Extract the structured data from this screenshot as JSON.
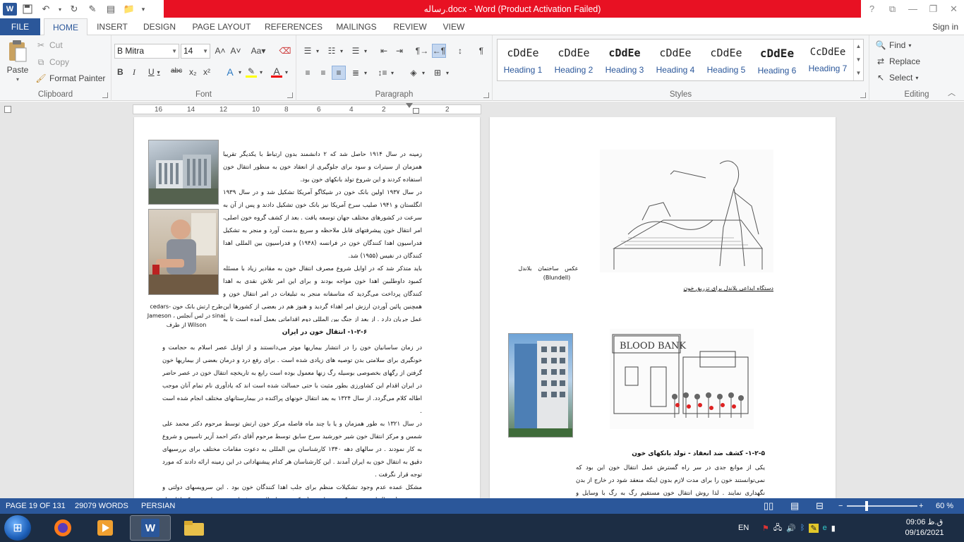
{
  "window": {
    "title": "رساله.docx -  Word (Product Activation Failed)"
  },
  "qat": {
    "customize": "▾"
  },
  "window_controls": {
    "help": "?",
    "restore_ribbon": "⧉",
    "minimize": "—",
    "maximize": "❐",
    "close": "✕"
  },
  "tabs": [
    "FILE",
    "HOME",
    "INSERT",
    "DESIGN",
    "PAGE LAYOUT",
    "REFERENCES",
    "MAILINGS",
    "REVIEW",
    "VIEW"
  ],
  "active_tab": "HOME",
  "signin": "Sign in",
  "clipboard": {
    "paste": "Paste",
    "cut": "Cut",
    "copy": "Copy",
    "format_painter": "Format Painter",
    "label": "Clipboard"
  },
  "font": {
    "name": "B Mitra",
    "size": "14",
    "label": "Font",
    "bold": "B",
    "italic": "I",
    "underline": "U",
    "strike": "abc",
    "sub": "x₂",
    "sup": "x²"
  },
  "paragraph": {
    "label": "Paragraph"
  },
  "styles": {
    "label": "Styles",
    "items": [
      {
        "sample": "cDdEe",
        "name": "Heading 1"
      },
      {
        "sample": "cDdEe",
        "name": "Heading 2"
      },
      {
        "sample": "cDdEe",
        "name": "Heading 3"
      },
      {
        "sample": "cDdEe",
        "name": "Heading 4"
      },
      {
        "sample": "cDdEe",
        "name": "Heading 5"
      },
      {
        "sample": "cDdEe",
        "name": "Heading 6"
      },
      {
        "sample": "CcDdEe",
        "name": "Heading 7"
      }
    ]
  },
  "editing": {
    "find": "Find",
    "replace": "Replace",
    "select": "Select",
    "label": "Editing"
  },
  "ruler": {
    "ticks": [
      "16",
      "14",
      "12",
      "10",
      "8",
      "6",
      "4",
      "2",
      "2"
    ]
  },
  "doc": {
    "left_page": {
      "paragraphs": [
        "زمینه در سال ۱۹۱۴ حاصل شد که ۲ دانشمند بدون ارتباط با یکدیگر تقریبا همزمان از سیترات و سود برای جلوگیری از انعقاد خون به منظور انتقال خون استفاده کردند و این شروع تولد بانکهای خون بود.",
        "در سال ۱۹۳۷ اولین بانک خون در شیکاگو آمریکا تشکیل شد و در سال ۱۹۳۹ انگلستان و ۱۹۴۱ صلیب سرخ آمریکا نیز بانک خون تشکیل دادند و پس از آن به سرعت در کشورهای مختلف جهان توسعه یافت . بعد از کشف گروه خون اصلی، امر انتقال خون پیشرفتهای قابل ملاحظه و سریع بدست آورد و منجر به تشکیل فدراسیون اهدا کنندگان خون در فرانسه (۱۹۴۸) و فدراسیون بین المللی اهدا کنندگان در نفیس (۱۹۵۵) شد.",
        "باید متذکر شد که در اوایل شروع مصرف انتقال خون به مقادیر زیاد با مسئله کمبود داوطلبین اهدا خون مواجه بودند و برای این امر تلاش نقدی به اهدا کنندگان پرداخت می‌گردید که متاسفانه منجر به تبلیغات در امر انتقال خون و همچنین پائین آوردن ارزش امر اهداء گردید و هنوز هم در بعضی از کشورها این عمل جریان دارد . از بعد از جنگ بین المللی دوم اقداماتی بعمل آمده است تا به خرید و فروش خون که تا حدی با خرید و فروش برده مطابقت دارد پایان داده شود."
      ],
      "heading": "۱-۲-۶- انتقال خون در ایران",
      "paragraphs2": [
        "در زمان ساسانیان خون را در انتشار بیماریها موثر می‌دانستند و از اوایل عصر اسلام به حجامت و خونگیری برای سلامتی بدن توصیه های زیادی شده است . برای رفع درد و درمان بعضی از بیماریها خون گرفتن از رگهای بخصوصی بوسیله رگ زنها معمول بوده است رابع به تاریخچه انتقال خون در عصر حاضر در ایران اقدام این کشاورزی بطور مثبت با حتی حسالت شده است اند که یادآوری نام تمام آنان موجب اطاله کلام می‌گردد. از سال ۱۳۲۴ به بعد انتقال خونهای پراکنده در بیمارستانهای مختلف انجام شده است .",
        "در سال ۱۳۲۱ به طور همزمان و یا با چند ماه فاصله مرکز خون ارتش توسط مرحوم دکتر محمد علی شمس و مرکز انتقال خون شیر خورشید سرخ سابق توسط مرحوم آقای دکتر احمد آزیر تاسیس و شروع به کار نمودند . در سالهای دهه ۱۳۴۰ کارشناسان بین المللی به دعوت مقامات مختلف برای بررسیهای دقیق به انتقال خون به ایران آمدند . این کارشناسان هر کدام پیشنهاداتی در این زمینه ارائه دادند که مورد توجه قرار نگرفت .",
        "مشکل عمده عدم وجود تشکیلات منظم برای جلب اهدا کنندگان خون بود . این سرویسهای دولتی و خصوصی (صندا) با حدودی مرکز خون ارتش ( حکمی به داوطلبین حرفه ای بودند . این عده که اغلب از افراد محروم جامعه بوده و کار منظمی نداشتند تنها ممر معاش آنها وجه ناچیزی بود که در مقابل خون خود دریافت می‌کردند. چون"
      ],
      "photo_caption": "طرح ارتش بانک خون cedars-sinai در لس آنجلس ، Jameson Wilson از طرف"
    },
    "right_page": {
      "img1_caption_a": "عکس  ساختمان   بلاندل",
      "img1_caption_b": "(Blundell)",
      "img1_title": "دستگاه ابداعی بلاندل برای تزریق خون",
      "bloodbank_sign": "BLOOD BANK",
      "heading": "۱-۲-۵- کشف ضد انعقاد - تولد بانکهای خون",
      "paragraph": "یکی از موانع جدی در سر راه گسترش عمل انتقال خون این بود که نمی‌توانستند خون را برای مدت لازم بدون اینکه منعقد شود در خارج از بدن نگهداری نمایند . لذا روش انتقال خون مستقیم رگ به رگ با وسایل و روشهای گوناگون معمول بود . پیشرفت عمده در این"
    }
  },
  "status": {
    "page": "PAGE 19 OF 131",
    "words": "29079 WORDS",
    "lang": "PERSIAN",
    "zoom": "60 %",
    "zoom_level": 0.6
  },
  "taskbar": {
    "lang": "EN",
    "time": "09:06 ق.ظ",
    "date": "09/16/2021"
  },
  "colors": {
    "brand": "#2b579a",
    "titlebar_alert": "#e81123"
  }
}
